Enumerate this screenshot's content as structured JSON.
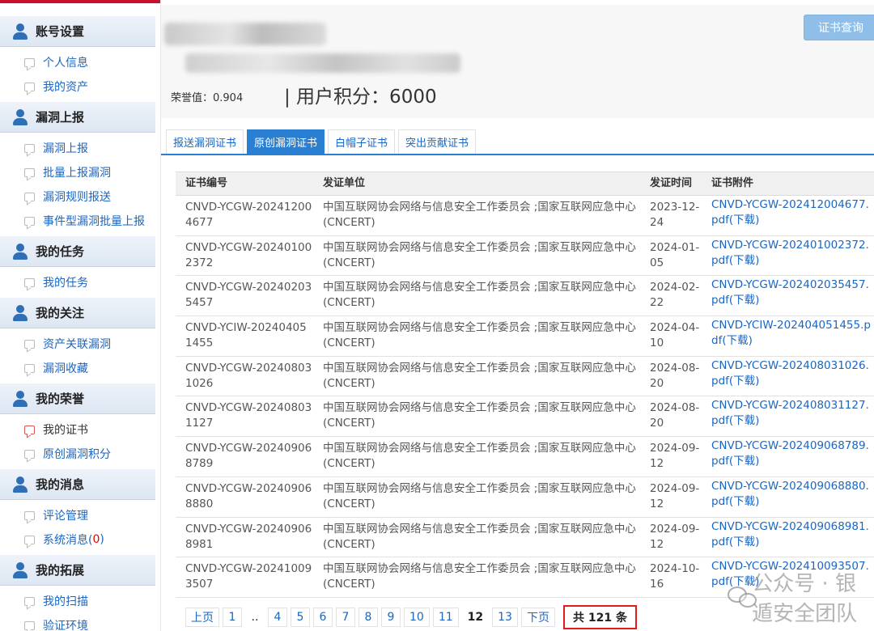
{
  "sidebar": {
    "sections": [
      {
        "title": "账号设置",
        "items": [
          "个人信息",
          "我的资产"
        ]
      },
      {
        "title": "漏洞上报",
        "items": [
          "漏洞上报",
          "批量上报漏洞",
          "漏洞规则报送",
          "事件型漏洞批量上报"
        ]
      },
      {
        "title": "我的任务",
        "items": [
          "我的任务"
        ]
      },
      {
        "title": "我的关注",
        "items": [
          "资产关联漏洞",
          "漏洞收藏"
        ]
      },
      {
        "title": "我的荣誉",
        "items": [
          "我的证书",
          "原创漏洞积分"
        ]
      },
      {
        "title": "我的消息",
        "items": [
          "评论管理",
          "系统消息("
        ]
      },
      {
        "title": "我的拓展",
        "items": [
          "我的扫描",
          "验证环境"
        ]
      }
    ],
    "system_msg_count": "0",
    "system_msg_close": ")"
  },
  "profile": {
    "honor_label": "荣誉值：0.904",
    "points_label": "| 用户积分：6000",
    "query_button": "证书查询"
  },
  "tabs": [
    "报送漏洞证书",
    "原创漏洞证书",
    "白帽子证书",
    "突出贡献证书"
  ],
  "table": {
    "headers": [
      "证书编号",
      "发证单位",
      "发证时间",
      "证书附件"
    ],
    "rows": [
      [
        "CNVD-YCGW-202412004677",
        "中国互联网协会网络与信息安全工作委员会 ;国家互联网应急中心 (CNCERT)",
        "2023-12-24",
        "CNVD-YCGW-202412004677.pdf(下载)"
      ],
      [
        "CNVD-YCGW-202401002372",
        "中国互联网协会网络与信息安全工作委员会 ;国家互联网应急中心 (CNCERT)",
        "2024-01-05",
        "CNVD-YCGW-202401002372.pdf(下载)"
      ],
      [
        "CNVD-YCGW-202402035457",
        "中国互联网协会网络与信息安全工作委员会 ;国家互联网应急中心 (CNCERT)",
        "2024-02-22",
        "CNVD-YCGW-202402035457.pdf(下载)"
      ],
      [
        "CNVD-YCIW-202404051455",
        "中国互联网协会网络与信息安全工作委员会 ;国家互联网应急中心 (CNCERT)",
        "2024-04-10",
        "CNVD-YCIW-202404051455.pdf(下载)"
      ],
      [
        "CNVD-YCGW-202408031026",
        "中国互联网协会网络与信息安全工作委员会 ;国家互联网应急中心 (CNCERT)",
        "2024-08-20",
        "CNVD-YCGW-202408031026.pdf(下载)"
      ],
      [
        "CNVD-YCGW-202408031127",
        "中国互联网协会网络与信息安全工作委员会 ;国家互联网应急中心 (CNCERT)",
        "2024-08-20",
        "CNVD-YCGW-202408031127.pdf(下载)"
      ],
      [
        "CNVD-YCGW-202409068789",
        "中国互联网协会网络与信息安全工作委员会 ;国家互联网应急中心 (CNCERT)",
        "2024-09-12",
        "CNVD-YCGW-202409068789.pdf(下载)"
      ],
      [
        "CNVD-YCGW-202409068880",
        "中国互联网协会网络与信息安全工作委员会 ;国家互联网应急中心 (CNCERT)",
        "2024-09-12",
        "CNVD-YCGW-202409068880.pdf(下载)"
      ],
      [
        "CNVD-YCGW-202409068981",
        "中国互联网协会网络与信息安全工作委员会 ;国家互联网应急中心 (CNCERT)",
        "2024-09-12",
        "CNVD-YCGW-202409068981.pdf(下载)"
      ],
      [
        "CNVD-YCGW-202410093507",
        "中国互联网协会网络与信息安全工作委员会 ;国家互联网应急中心 (CNCERT)",
        "2024-10-16",
        "CNVD-YCGW-202410093507.pdf(下载)"
      ]
    ]
  },
  "pager": {
    "prev": "上页",
    "pages": [
      "1",
      "..",
      "4",
      "5",
      "6",
      "7",
      "8",
      "9",
      "10",
      "11",
      "12",
      "13"
    ],
    "current": "12",
    "next": "下页",
    "total": "共 121 条"
  },
  "watermark": "公众号 · 银遁安全团队"
}
